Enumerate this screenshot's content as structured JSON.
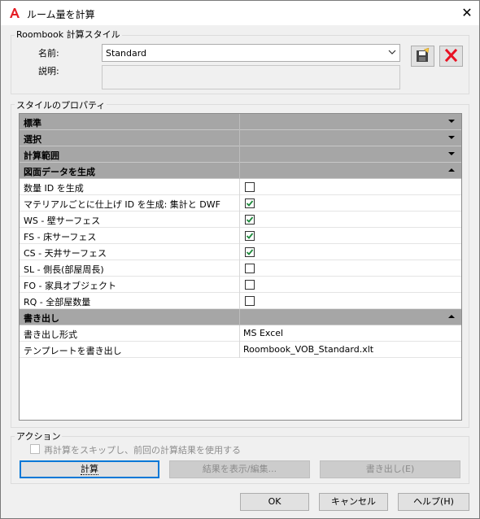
{
  "window": {
    "title": "ルーム量を計算",
    "close_glyph": "✕"
  },
  "style_group": {
    "title": "Roombook 計算スタイル",
    "name_label": "名前:",
    "name_value": "Standard",
    "desc_label": "説明:",
    "desc_value": ""
  },
  "props_group": {
    "title": "スタイルのプロパティ",
    "rows": [
      {
        "type": "cat",
        "label": "標準",
        "expanded": false
      },
      {
        "type": "cat",
        "label": "選択",
        "expanded": false
      },
      {
        "type": "cat",
        "label": "計算範囲",
        "expanded": false
      },
      {
        "type": "cat",
        "label": "図面データを生成",
        "expanded": true
      },
      {
        "type": "check",
        "label": "数量 ID を生成",
        "checked": false
      },
      {
        "type": "check",
        "label": "マテリアルごとに仕上げ ID を生成: 集計と DWF",
        "checked": true
      },
      {
        "type": "check",
        "label": "WS - 壁サーフェス",
        "checked": true
      },
      {
        "type": "check",
        "label": "FS - 床サーフェス",
        "checked": true
      },
      {
        "type": "check",
        "label": "CS - 天井サーフェス",
        "checked": true
      },
      {
        "type": "check",
        "label": "SL - 側長(部屋周長)",
        "checked": false
      },
      {
        "type": "check",
        "label": "FO - 家具オブジェクト",
        "checked": false
      },
      {
        "type": "check",
        "label": "RQ - 全部屋数量",
        "checked": false
      },
      {
        "type": "cat",
        "label": "書き出し",
        "expanded": true
      },
      {
        "type": "text",
        "label": "書き出し形式",
        "value": "MS Excel"
      },
      {
        "type": "text",
        "label": "テンプレートを書き出し",
        "value": "Roombook_VOB_Standard.xlt"
      }
    ]
  },
  "action_group": {
    "title": "アクション",
    "skip_label": "再計算をスキップし、前回の計算結果を使用する",
    "skip_checked": false,
    "calc_button": "計算",
    "show_button": "結果を表示/編集...",
    "export_button": "書き出し(E)"
  },
  "footer": {
    "ok": "OK",
    "cancel": "キャンセル",
    "help": "ヘルプ(H)"
  },
  "colors": {
    "accent": "#0078d7",
    "check": "#1e8a3c",
    "delete": "#e81123",
    "category_bg": "#a6a6a6"
  }
}
